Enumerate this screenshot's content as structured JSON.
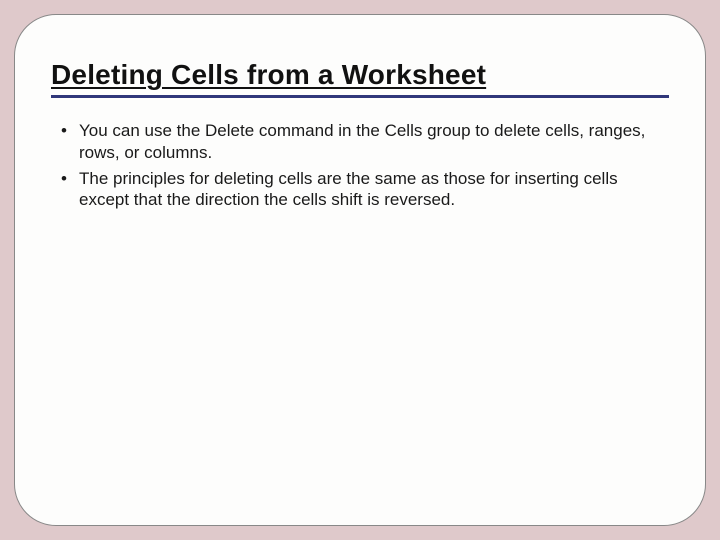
{
  "slide": {
    "title": "Deleting Cells from a Worksheet",
    "bullets": [
      "You can use the Delete command in the Cells group to delete cells, ranges, rows, or columns.",
      "The principles for deleting cells are the same as those for inserting cells except that the direction the cells shift is reversed."
    ]
  }
}
